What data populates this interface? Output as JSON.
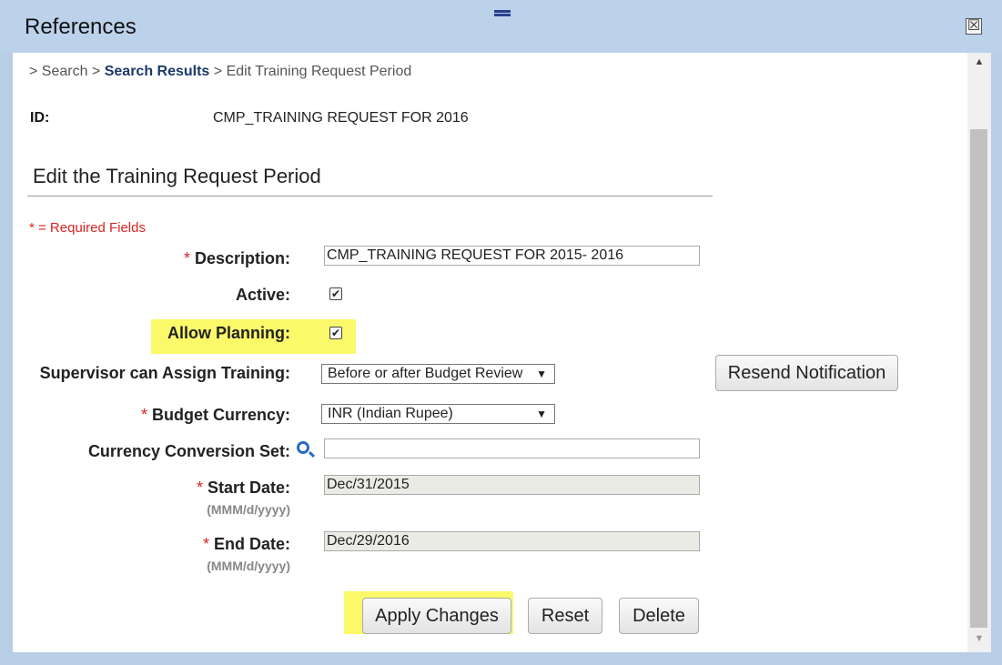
{
  "window": {
    "title": "References",
    "close_glyph": "☒"
  },
  "breadcrumb": {
    "prefix1": "> Search",
    "sep": " > ",
    "link": "Search Results",
    "current": "Edit Training Request Period"
  },
  "record": {
    "id_label": "ID:",
    "id_value": "CMP_TRAINING REQUEST FOR 2016"
  },
  "section": {
    "title": "Edit the Training Request Period"
  },
  "required_note": "* = Required Fields",
  "form": {
    "required_mark": "*",
    "description": {
      "label": "Description:",
      "value": "CMP_TRAINING REQUEST FOR 2015- 2016"
    },
    "active": {
      "label": "Active:",
      "checked": true
    },
    "allow_planning": {
      "label": "Allow Planning:",
      "checked": true
    },
    "supervisor": {
      "label": "Supervisor can Assign Training:",
      "selected": "Before or after Budget Review"
    },
    "budget_currency": {
      "label": "Budget Currency:",
      "selected": "INR (Indian Rupee)"
    },
    "conversion_set": {
      "label": "Currency Conversion Set:",
      "value": ""
    },
    "start_date": {
      "label": "Start Date:",
      "hint": "(MMM/d/yyyy)",
      "value": "Dec/31/2015"
    },
    "end_date": {
      "label": "End Date:",
      "hint": "(MMM/d/yyyy)",
      "value": "Dec/29/2016"
    }
  },
  "buttons": {
    "resend": "Resend Notification",
    "apply": "Apply Changes",
    "reset": "Reset",
    "delete": "Delete"
  },
  "icons": {
    "check": "✔",
    "dropdown_arrow": "▼",
    "scroll_up": "▲",
    "scroll_down": "▼"
  },
  "colors": {
    "highlight": "#fbf96a",
    "required": "#dd2222",
    "link": "#1b3a6b"
  }
}
